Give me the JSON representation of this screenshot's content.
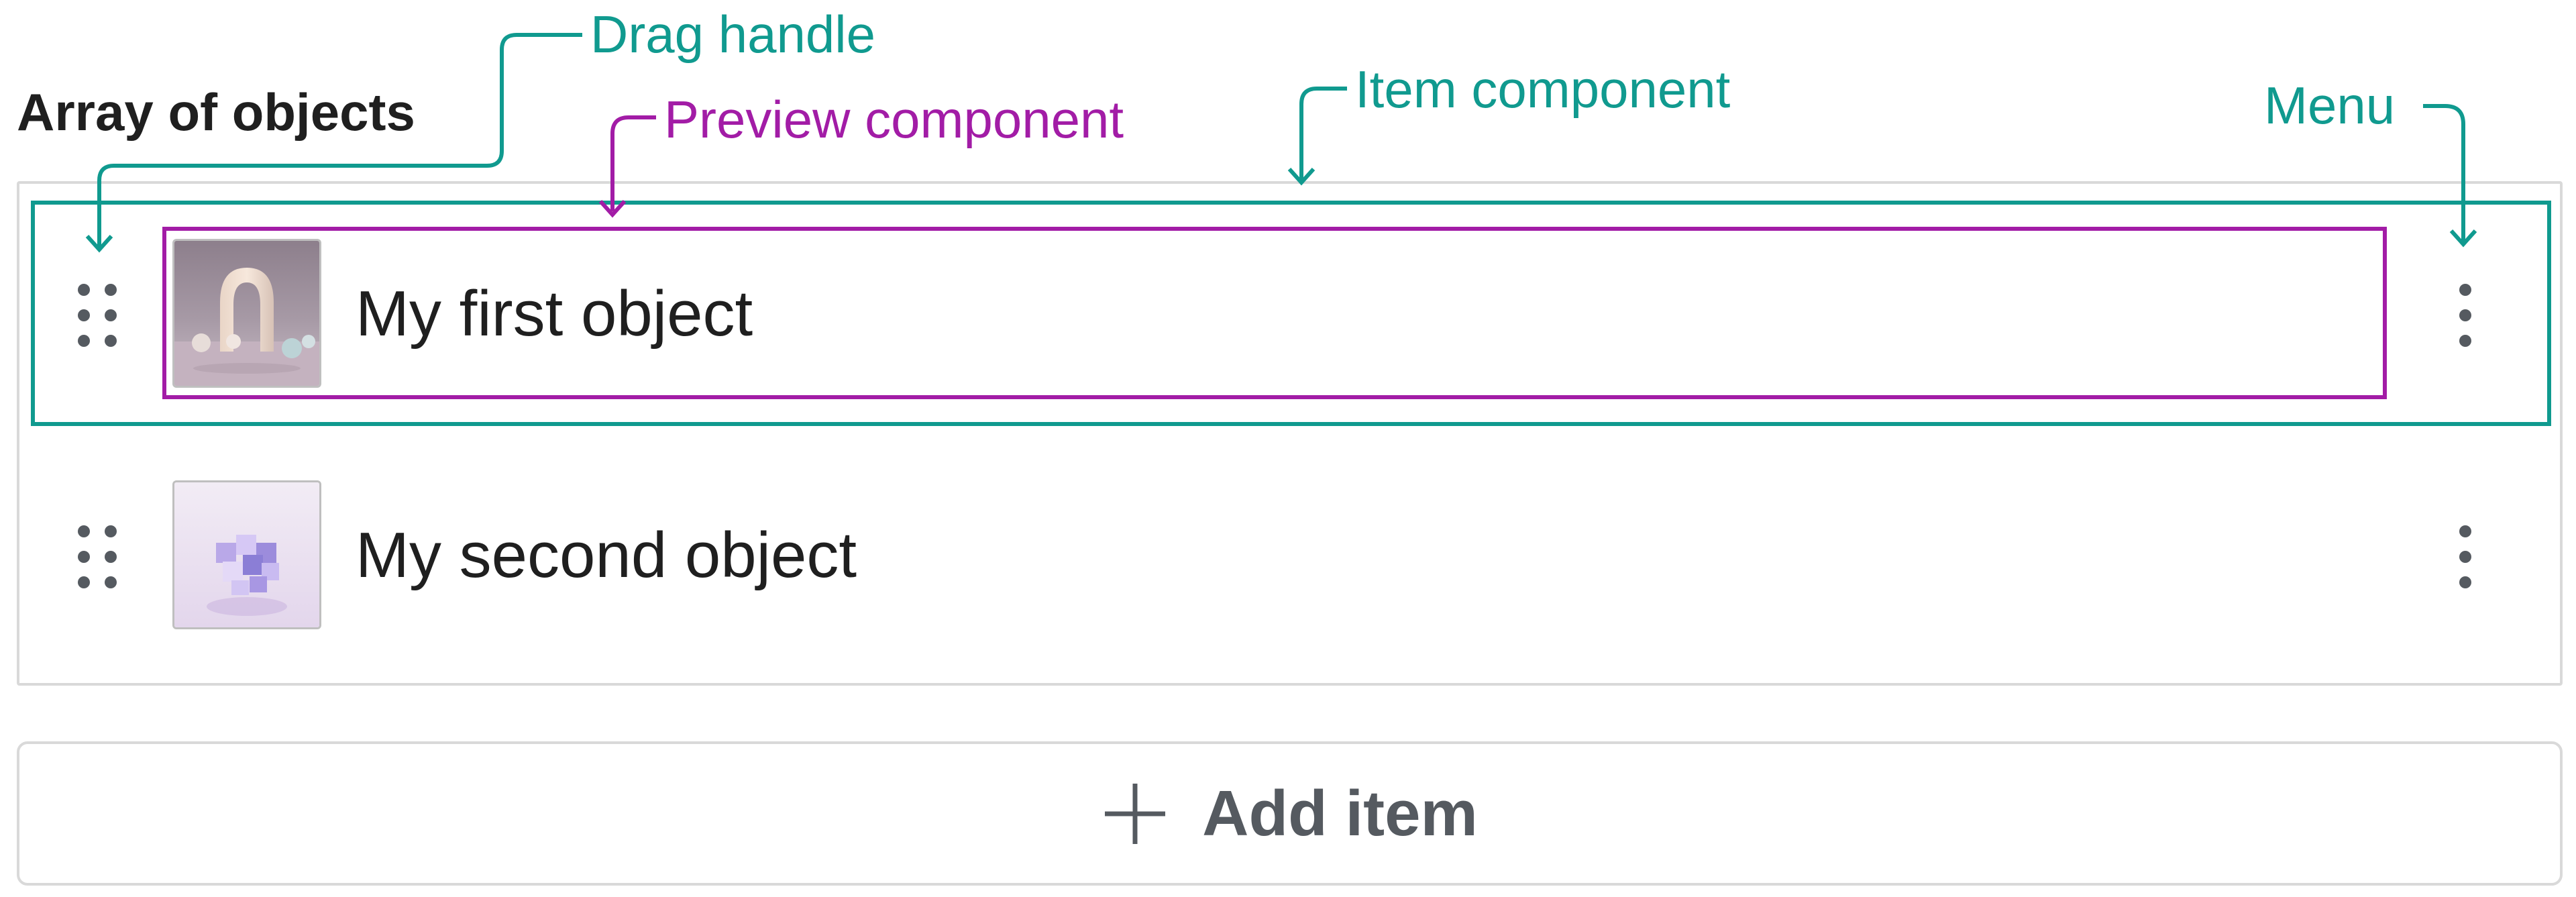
{
  "field": {
    "title": "Array of objects"
  },
  "items": [
    {
      "title": "My first object",
      "thumbnail_icon": "arch-scene-image"
    },
    {
      "title": "My second object",
      "thumbnail_icon": "cube-cluster-image"
    }
  ],
  "add_button": {
    "label": "Add item",
    "icon": "plus-icon"
  },
  "annotations": {
    "drag_handle": "Drag handle",
    "preview_component": "Preview component",
    "item_component": "Item component",
    "menu": "Menu"
  },
  "colors": {
    "annotation_teal": "#109a8f",
    "annotation_purple": "#a21ca6",
    "border": "#d9d9d9",
    "text": "#1f1f1f"
  }
}
